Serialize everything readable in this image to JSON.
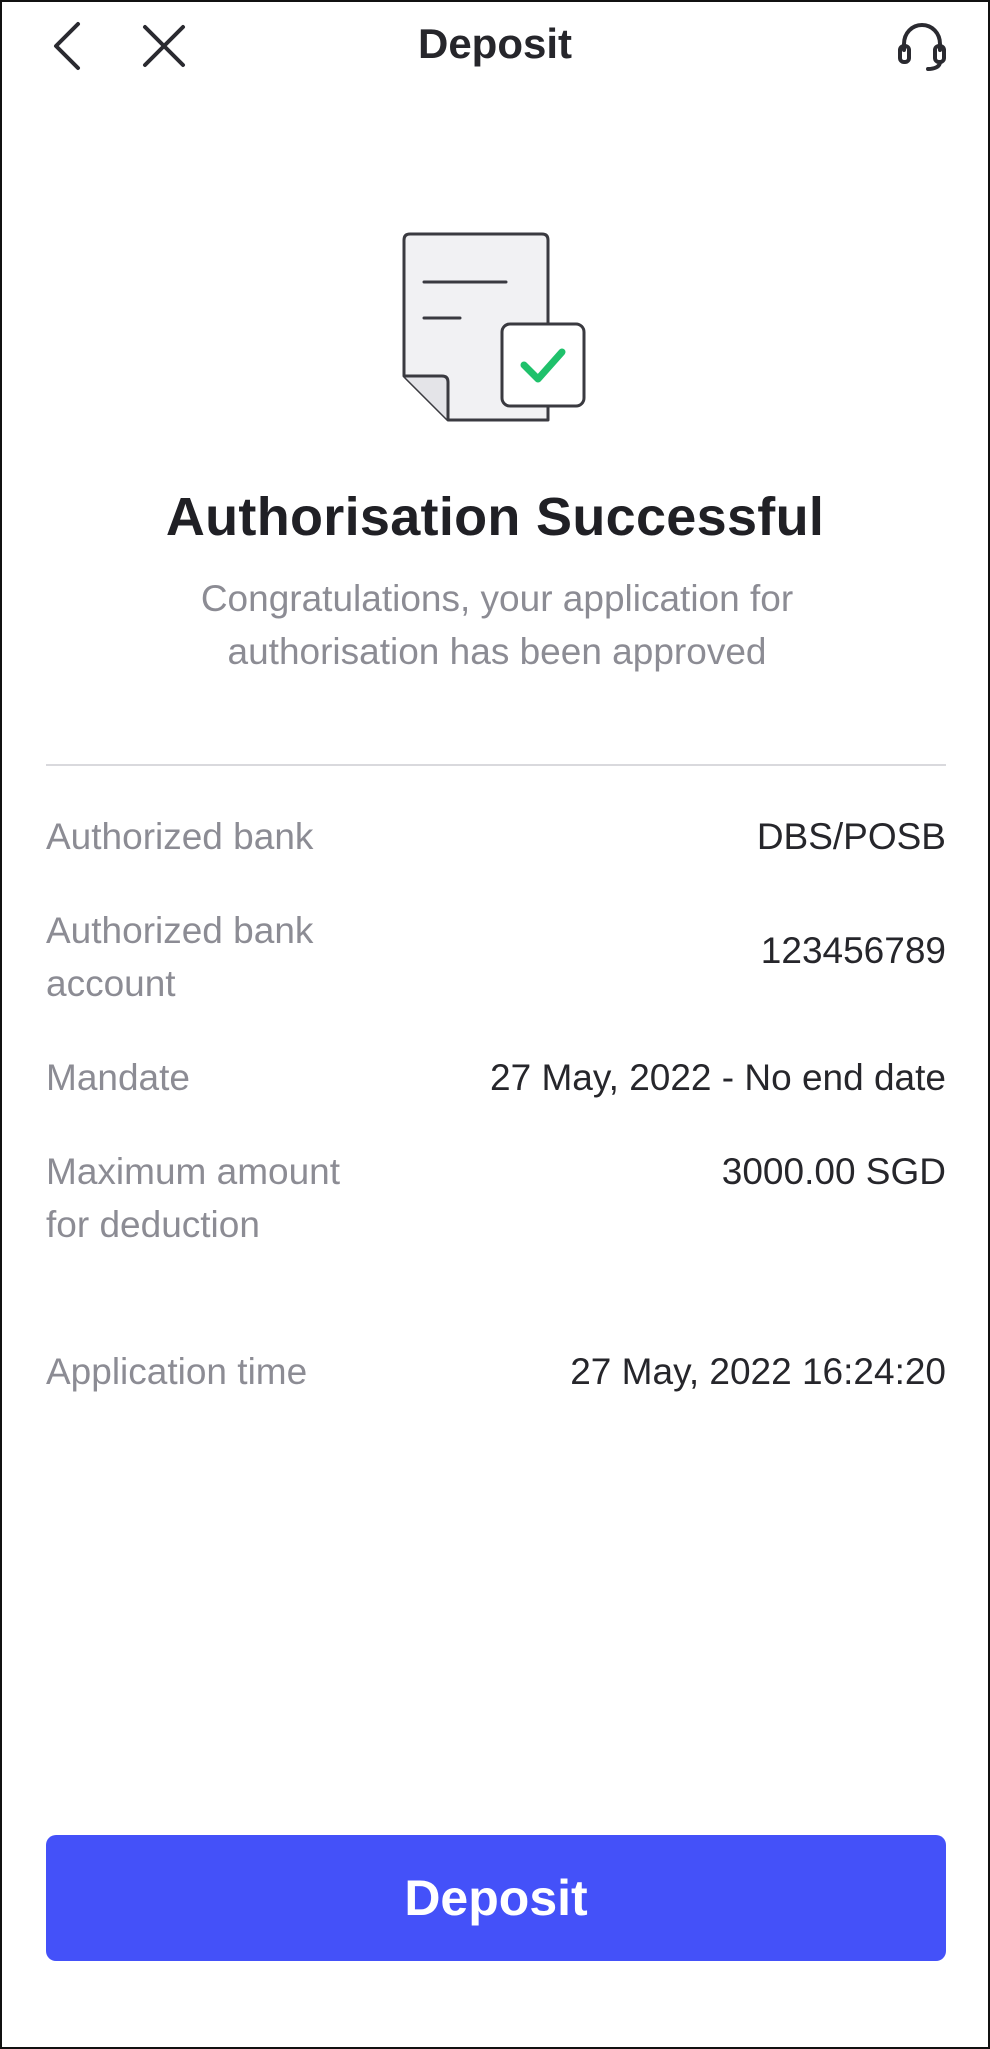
{
  "header": {
    "title": "Deposit",
    "back_icon": "chevron-left-icon",
    "close_icon": "close-icon",
    "support_icon": "headset-icon"
  },
  "hero": {
    "icon": "document-check-icon",
    "heading": "Authorisation Successful",
    "subtext": "Congratulations, your application for authorisation has been approved"
  },
  "details": [
    {
      "label": "Authorized bank",
      "value": "DBS/POSB"
    },
    {
      "label": "Authorized bank account",
      "value": "123456789"
    },
    {
      "label": "Mandate",
      "value": "27 May, 2022 - No end date"
    },
    {
      "label": "Maximum amount for deduction",
      "value": "3000.00 SGD"
    },
    {
      "label": "Application time",
      "value": "27 May, 2022 16:24:20"
    }
  ],
  "cta": {
    "label": "Deposit"
  },
  "colors": {
    "primary": "#4451f9",
    "success": "#1fc16b",
    "muted_text": "#8c8c94",
    "text": "#26262b"
  }
}
